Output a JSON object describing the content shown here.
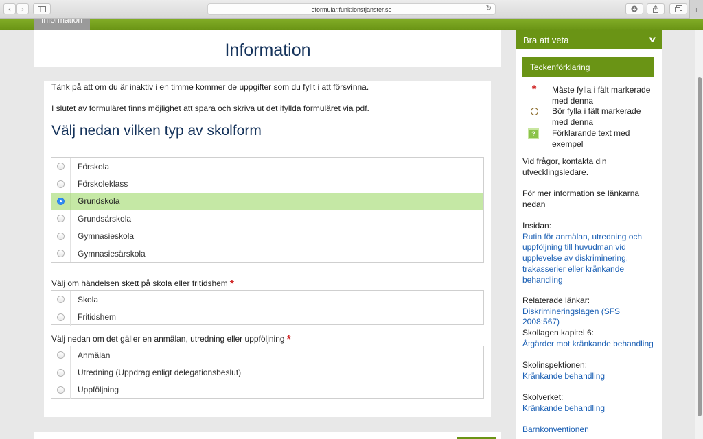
{
  "browser": {
    "url": "eformular.funktionstjanster.se",
    "back_icon": "‹",
    "forward_icon": "›",
    "reload_icon": "↻",
    "newtab_icon": "+"
  },
  "tab": {
    "label": "Information"
  },
  "page": {
    "title": "Information",
    "intro1": "Tänk på att om du är inaktiv i en timme kommer de uppgifter som du fyllt i att försvinna.",
    "intro2": "I slutet av formuläret finns möjlighet att spara och skriva ut det ifyllda formuläret via pdf."
  },
  "question1": {
    "title": "Välj nedan vilken typ av skolform",
    "options": [
      "Förskola",
      "Förskoleklass",
      "Grundskola",
      "Grundsärskola",
      "Gymnasieskola",
      "Gymnasiesärskola"
    ],
    "selected": "Grundskola"
  },
  "question2": {
    "label": "Välj om händelsen skett på skola eller fritidshem",
    "required_mark": "*",
    "options": [
      "Skola",
      "Fritidshem"
    ]
  },
  "question3": {
    "label": "Välj nedan om det gäller en anmälan, utredning eller uppföljning",
    "required_mark": "*",
    "options": [
      "Anmälan",
      "Utredning (Uppdrag enligt delegationsbeslut)",
      "Uppföljning"
    ]
  },
  "sidebar": {
    "header": "Bra att veta",
    "legend_title": "Teckenförklaring",
    "legend": [
      {
        "icon": "required-star-icon",
        "glyph": "*",
        "text": "Måste fylla i fält markerade med denna"
      },
      {
        "icon": "optional-circle-icon",
        "glyph": "",
        "text": "Bör fylla i fält markerade med denna"
      },
      {
        "icon": "help-icon",
        "glyph": "?",
        "text": "Förklarande text med exempel"
      }
    ],
    "contact": "Vid frågor, kontakta din utvecklingsledare.",
    "more_info": "För mer information se länkarna nedan",
    "insidan_label": "Insidan:",
    "insidan_link": "Rutin för anmälan, utredning och uppföljning till huvudman vid upplevelse av diskriminering, trakasserier eller kränkande behandling",
    "related_label": "Relaterade länkar:",
    "related_link": "Diskrimineringslagen (SFS 2008:567)",
    "skollagen_label": "Skollagen kapitel 6:",
    "skollagen_link": "Åtgärder mot kränkande behandling",
    "skolinsp_label": "Skolinspektionen:",
    "skolinsp_link": "Kränkande behandling",
    "skolverket_label": "Skolverket:",
    "skolverket_link": "Kränkande behandling",
    "barnkonv_link": "Barnkonventionen"
  },
  "colors": {
    "brand_green": "#6a9415",
    "selected_row": "#c5e8a5",
    "link": "#1a5fb4",
    "required": "#d12a2a"
  }
}
